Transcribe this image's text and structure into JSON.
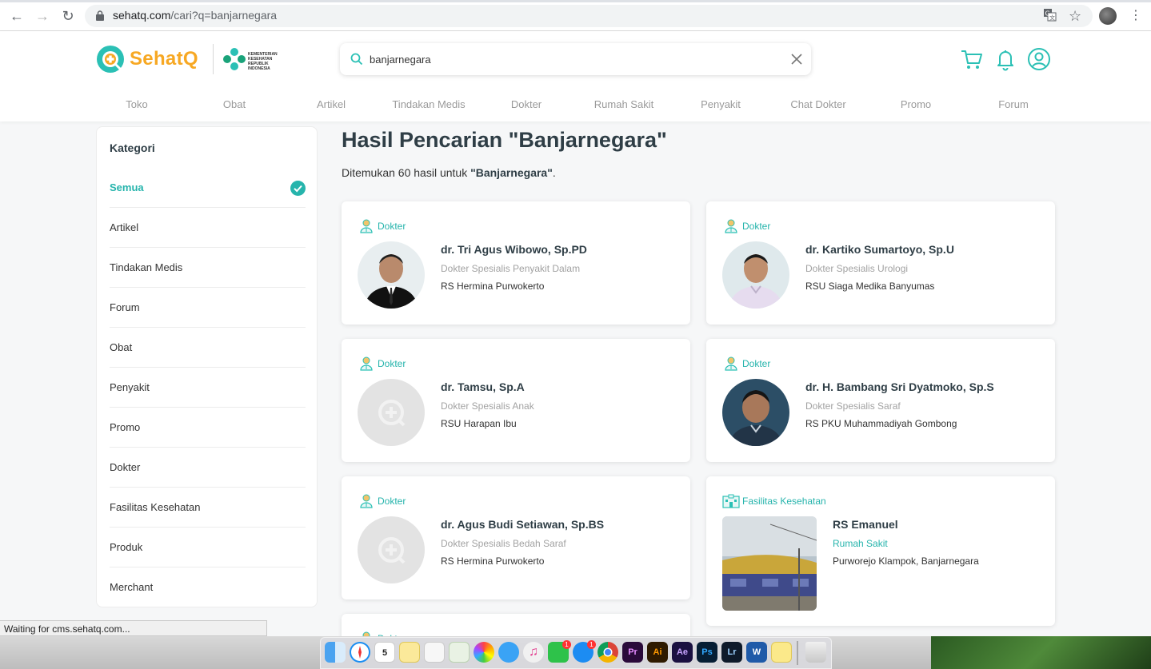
{
  "browser": {
    "url_host": "sehatq.com",
    "url_path": "/cari?q=banjarnegara"
  },
  "header": {
    "logo_text": "SehatQ",
    "kemenkes_text": "KEMENTERIAN KESEHATAN REPUBLIK INDONESIA",
    "search_value": "banjarnegara",
    "nav": [
      "Toko",
      "Obat",
      "Artikel",
      "Tindakan Medis",
      "Dokter",
      "Rumah Sakit",
      "Penyakit",
      "Chat Dokter",
      "Promo",
      "Forum"
    ]
  },
  "sidebar": {
    "title": "Kategori",
    "items": [
      {
        "label": "Semua",
        "active": true
      },
      {
        "label": "Artikel"
      },
      {
        "label": "Tindakan Medis"
      },
      {
        "label": "Forum"
      },
      {
        "label": "Obat"
      },
      {
        "label": "Penyakit"
      },
      {
        "label": "Promo"
      },
      {
        "label": "Dokter"
      },
      {
        "label": "Fasilitas Kesehatan"
      },
      {
        "label": "Produk"
      },
      {
        "label": "Merchant"
      }
    ]
  },
  "results": {
    "title": "Hasil Pencarian \"Banjarnegara\"",
    "summary_prefix": "Ditemukan 60 hasil untuk ",
    "summary_query": "\"Banjarnegara\"",
    "summary_suffix": ".",
    "cards": [
      {
        "type": "Dokter",
        "name": "dr. Tri Agus Wibowo, Sp.PD",
        "spec": "Dokter Spesialis Penyakit Dalam",
        "place": "RS Hermina Purwokerto"
      },
      {
        "type": "Dokter",
        "name": "dr. Kartiko Sumartoyo, Sp.U",
        "spec": "Dokter Spesialis Urologi",
        "place": "RSU Siaga Medika Banyumas"
      },
      {
        "type": "Dokter",
        "name": "dr. Tamsu, Sp.A",
        "spec": "Dokter Spesialis Anak",
        "place": "RSU Harapan Ibu"
      },
      {
        "type": "Dokter",
        "name": "dr. H. Bambang Sri Dyatmoko, Sp.S",
        "spec": "Dokter Spesialis Saraf",
        "place": "RS PKU Muhammadiyah Gombong"
      },
      {
        "type": "Dokter",
        "name": "dr. Agus Budi Setiawan, Sp.BS",
        "spec": "Dokter Spesialis Bedah Saraf",
        "place": "RS Hermina Purwokerto"
      },
      {
        "type": "Fasilitas Kesehatan",
        "name": "RS Emanuel",
        "spec": "Rumah Sakit",
        "place": "Purworejo Klampok, Banjarnegara"
      },
      {
        "type": "Dokter"
      }
    ]
  },
  "status_bar": "Waiting for cms.sehatq.com...",
  "dock": {
    "calendar_day": "5",
    "badge": "1",
    "apps": [
      "Pr",
      "Ai",
      "Ae",
      "Ps",
      "Lr",
      "W"
    ]
  },
  "colors": {
    "brand_teal": "#26b4ac",
    "brand_orange": "#f7a823",
    "title_dark": "#2f3e46"
  }
}
